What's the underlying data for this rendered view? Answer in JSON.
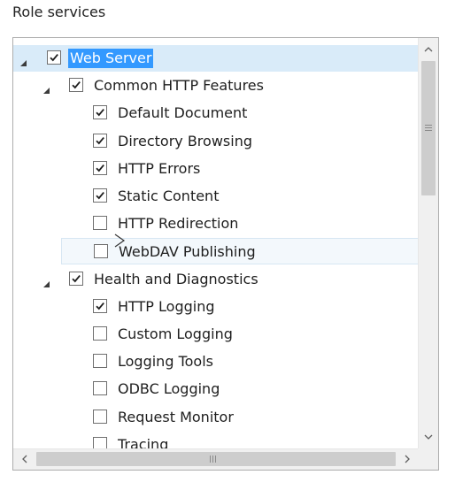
{
  "section": {
    "title": "Role services"
  },
  "tree": {
    "items": [
      {
        "label": "Web Server",
        "level": 0,
        "checked": true,
        "expanded": true,
        "selected": true
      },
      {
        "label": "Common HTTP Features",
        "level": 1,
        "checked": true,
        "expanded": true
      },
      {
        "label": "Default Document",
        "level": 2,
        "checked": true
      },
      {
        "label": "Directory Browsing",
        "level": 2,
        "checked": true
      },
      {
        "label": "HTTP Errors",
        "level": 2,
        "checked": true
      },
      {
        "label": "Static Content",
        "level": 2,
        "checked": true
      },
      {
        "label": "HTTP Redirection",
        "level": 2,
        "checked": false
      },
      {
        "label": "WebDAV Publishing",
        "level": 2,
        "checked": false,
        "hovered": true
      },
      {
        "label": "Health and Diagnostics",
        "level": 1,
        "checked": true,
        "expanded": true
      },
      {
        "label": "HTTP Logging",
        "level": 2,
        "checked": true
      },
      {
        "label": "Custom Logging",
        "level": 2,
        "checked": false
      },
      {
        "label": "Logging Tools",
        "level": 2,
        "checked": false
      },
      {
        "label": "ODBC Logging",
        "level": 2,
        "checked": false
      },
      {
        "label": "Request Monitor",
        "level": 2,
        "checked": false
      },
      {
        "label": "Tracing",
        "level": 2,
        "checked": false
      }
    ]
  },
  "colors": {
    "selection": "#3399ff",
    "selection_row": "#d9ebf9",
    "scrollbar_track": "#f0f0f0",
    "scrollbar_thumb": "#cdcdcd"
  }
}
